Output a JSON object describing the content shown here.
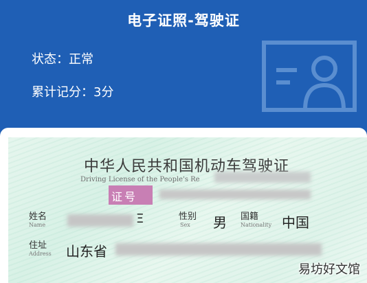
{
  "header": {
    "title": "电子证照-驾驶证",
    "status_text": "状态：正常",
    "points_text": "累计记分：3分",
    "icon": "id-card-icon"
  },
  "license": {
    "title": "中华人民共和国机动车驾驶证",
    "subtitle": "Driving License of the People's Re",
    "number_label": "证号",
    "fields": {
      "name_cn": "姓名",
      "name_en": "Name",
      "name_partial": "Ξ",
      "sex_cn": "性别",
      "sex_en": "Sex",
      "sex_value": "男",
      "nationality_cn": "国籍",
      "nationality_en": "Nationality",
      "nationality_value": "中国",
      "address_cn": "住址",
      "address_en": "Address",
      "address_value": "山东省"
    }
  },
  "watermark": "易坊好文馆",
  "colors": {
    "header_bg": "#1f5fb5",
    "number_badge": "#c87fb4",
    "card_bg": "#dff3ea"
  }
}
